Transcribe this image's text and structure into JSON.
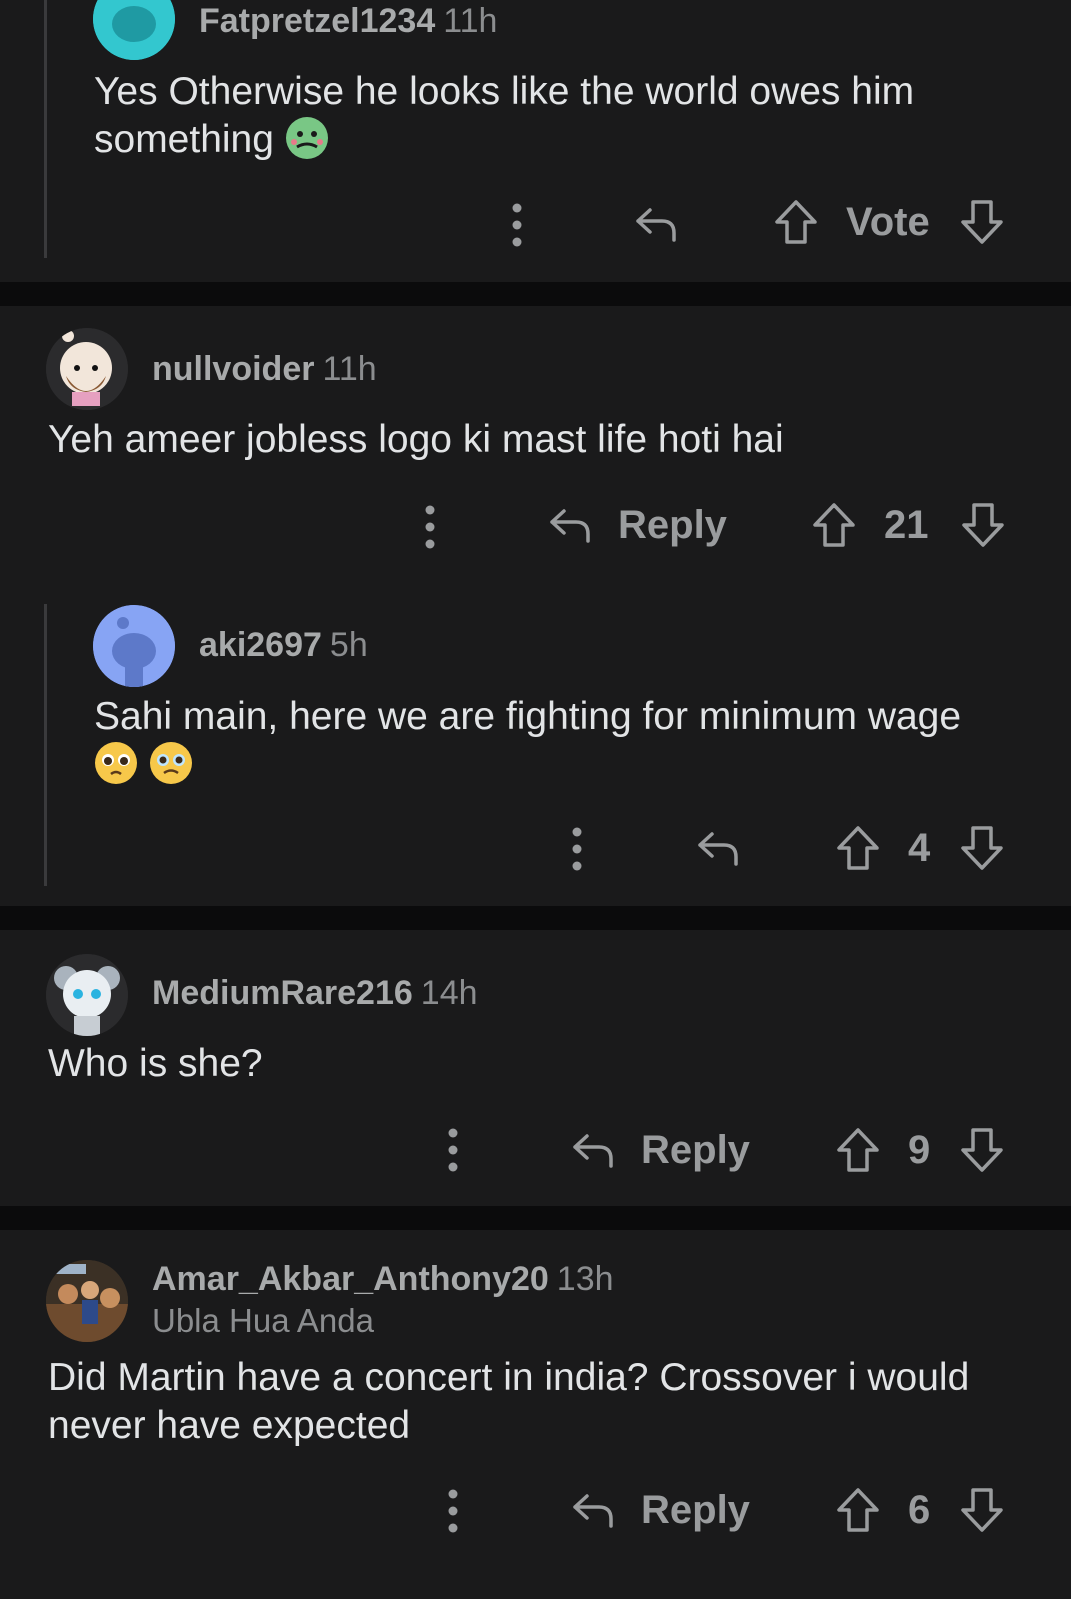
{
  "comments": [
    {
      "username": "Fatpretzel1234",
      "time": "11h",
      "avatar": "snoo-avatar-cyan",
      "body": "Yes Otherwise he looks like the world owes him something",
      "emoji": [
        "nauseated-face"
      ],
      "reply_label": "",
      "score": "Vote",
      "depth": 1
    },
    {
      "username": "nullvoider",
      "time": "11h",
      "avatar": "snoo-avatar-bearded",
      "body": "Yeh ameer jobless logo ki mast life hoti hai",
      "reply_label": "Reply",
      "score": "21",
      "depth": 0
    },
    {
      "username": "aki2697",
      "time": "5h",
      "avatar": "snoo-avatar-blue",
      "body": "Sahi main, here we are fighting for minimum wage",
      "emoji": [
        "pleading-face",
        "holding-back-tears-face"
      ],
      "reply_label": "",
      "score": "4",
      "depth": 1
    },
    {
      "username": "MediumRare216",
      "time": "14h",
      "avatar": "snoo-avatar-koala",
      "body": "Who is she?",
      "reply_label": "Reply",
      "score": "9",
      "depth": 0
    },
    {
      "username": "Amar_Akbar_Anthony20",
      "time": "13h",
      "flair": "Ubla Hua Anda",
      "avatar": "photo-avatar",
      "body": "Did Martin have a concert in india? Crossover i would never have expected",
      "reply_label": "Reply",
      "score": "6",
      "depth": 0
    }
  ],
  "icons": {
    "more": "vertical-dots-icon",
    "reply": "reply-arrow-icon",
    "upvote": "upvote-arrow-icon",
    "downvote": "downvote-arrow-icon"
  },
  "colors": {
    "background": "#1a1a1b",
    "separator": "#0b0b0c",
    "text": "#e2e4e6",
    "muted": "#9a9c9e"
  }
}
